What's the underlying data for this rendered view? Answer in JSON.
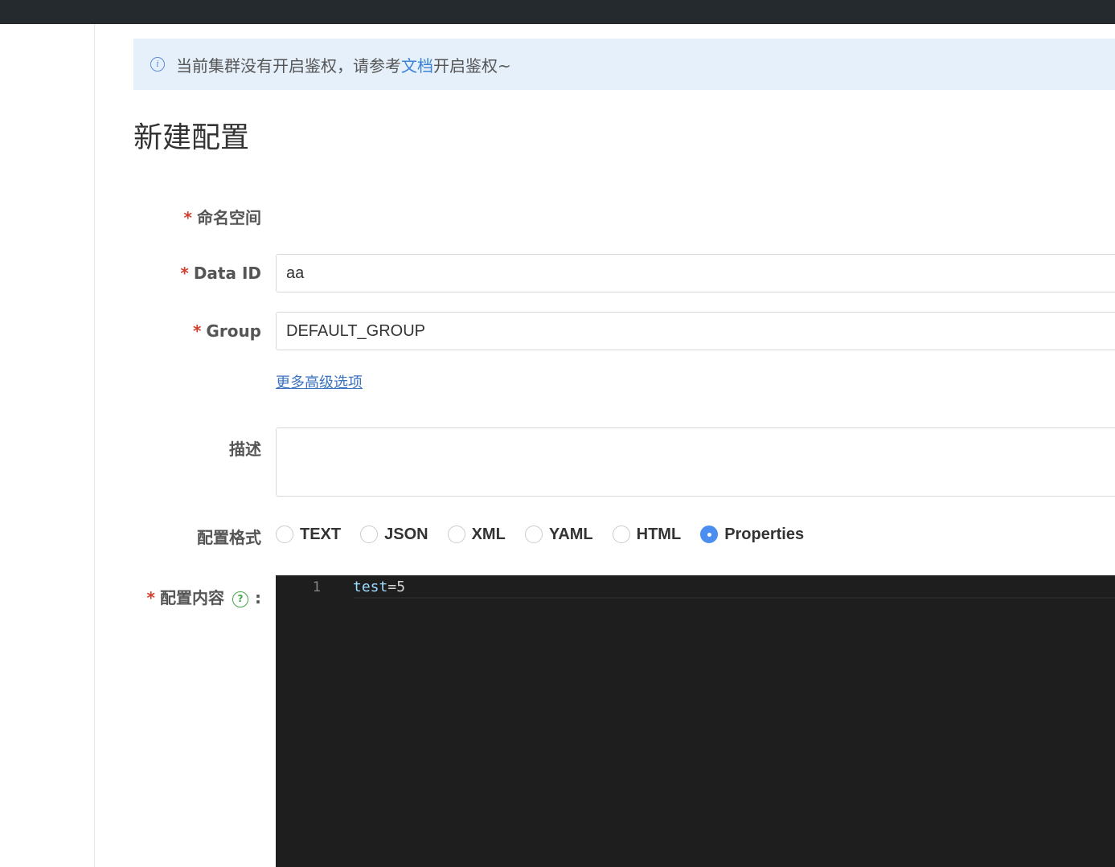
{
  "notice": {
    "text_before": "当前集群没有开启鉴权，请参考",
    "link": "文档",
    "text_after": "开启鉴权~"
  },
  "page_title": "新建配置",
  "form": {
    "required_mark": "*",
    "namespace_label": "命名空间",
    "data_id_label": "Data ID",
    "data_id_value": "aa",
    "group_label": "Group",
    "group_value": "DEFAULT_GROUP",
    "advanced_link": "更多高级选项",
    "description_label": "描述",
    "description_value": "",
    "format_label": "配置格式",
    "formats": [
      {
        "label": "TEXT",
        "checked": false
      },
      {
        "label": "JSON",
        "checked": false
      },
      {
        "label": "XML",
        "checked": false
      },
      {
        "label": "YAML",
        "checked": false
      },
      {
        "label": "HTML",
        "checked": false
      },
      {
        "label": "Properties",
        "checked": true
      }
    ],
    "content_label": "配置内容",
    "help_glyph": "?",
    "content_colon": ":"
  },
  "editor": {
    "line_number": "1",
    "key": "test",
    "operator": "=",
    "value": "5"
  },
  "colors": {
    "topbar": "#252a2f",
    "notice_bg": "#e6f0fb",
    "accent": "#4a8ef0",
    "required": "#d0402e",
    "editor_bg": "#1e1e1e"
  }
}
